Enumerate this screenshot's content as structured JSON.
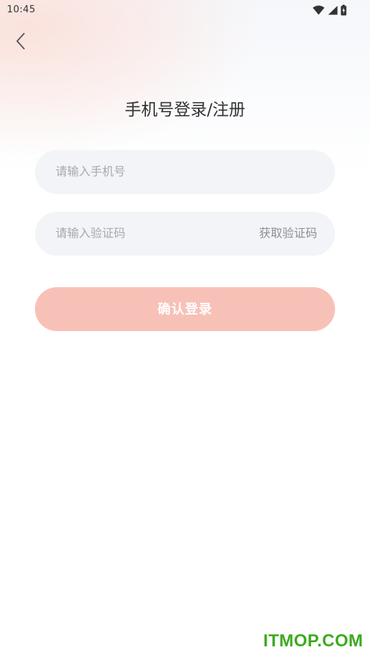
{
  "status_bar": {
    "time": "10:45",
    "icons": [
      "wifi-icon",
      "cellular-signal-icon",
      "battery-charging-icon"
    ]
  },
  "header": {
    "back_icon": "chevron-left-icon",
    "title": "手机号登录/注册"
  },
  "form": {
    "phone": {
      "value": "",
      "placeholder": "请输入手机号"
    },
    "code": {
      "value": "",
      "placeholder": "请输入验证码",
      "get_code_label": "获取验证码"
    },
    "confirm_label": "确认登录"
  },
  "watermark": "ITMOP.COM",
  "colors": {
    "accent_disabled": "#f8c1b7",
    "input_bg": "#f3f4f8",
    "watermark": "#3caa1e"
  }
}
